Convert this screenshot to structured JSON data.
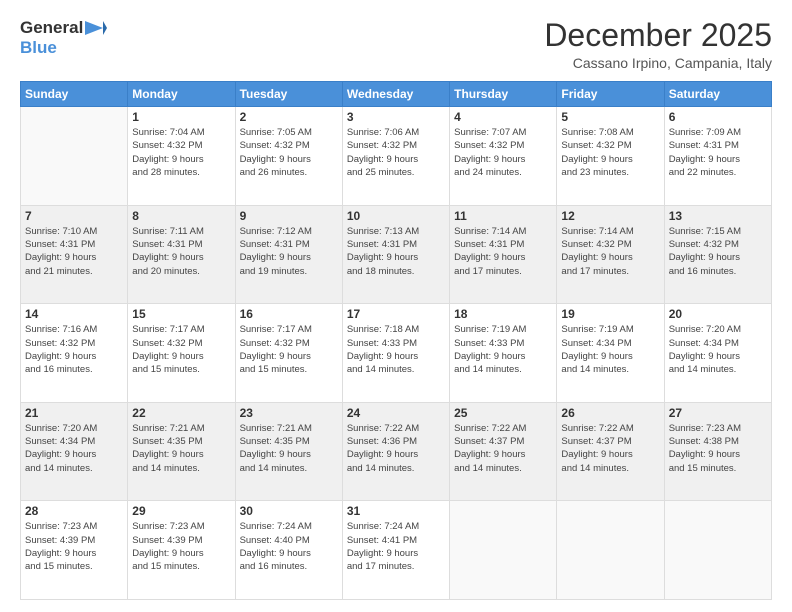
{
  "header": {
    "logo_line1": "General",
    "logo_line2": "Blue",
    "month_title": "December 2025",
    "location": "Cassano Irpino, Campania, Italy"
  },
  "weekdays": [
    "Sunday",
    "Monday",
    "Tuesday",
    "Wednesday",
    "Thursday",
    "Friday",
    "Saturday"
  ],
  "rows": [
    [
      {
        "day": "",
        "info": ""
      },
      {
        "day": "1",
        "info": "Sunrise: 7:04 AM\nSunset: 4:32 PM\nDaylight: 9 hours\nand 28 minutes."
      },
      {
        "day": "2",
        "info": "Sunrise: 7:05 AM\nSunset: 4:32 PM\nDaylight: 9 hours\nand 26 minutes."
      },
      {
        "day": "3",
        "info": "Sunrise: 7:06 AM\nSunset: 4:32 PM\nDaylight: 9 hours\nand 25 minutes."
      },
      {
        "day": "4",
        "info": "Sunrise: 7:07 AM\nSunset: 4:32 PM\nDaylight: 9 hours\nand 24 minutes."
      },
      {
        "day": "5",
        "info": "Sunrise: 7:08 AM\nSunset: 4:32 PM\nDaylight: 9 hours\nand 23 minutes."
      },
      {
        "day": "6",
        "info": "Sunrise: 7:09 AM\nSunset: 4:31 PM\nDaylight: 9 hours\nand 22 minutes."
      }
    ],
    [
      {
        "day": "7",
        "info": "Sunrise: 7:10 AM\nSunset: 4:31 PM\nDaylight: 9 hours\nand 21 minutes."
      },
      {
        "day": "8",
        "info": "Sunrise: 7:11 AM\nSunset: 4:31 PM\nDaylight: 9 hours\nand 20 minutes."
      },
      {
        "day": "9",
        "info": "Sunrise: 7:12 AM\nSunset: 4:31 PM\nDaylight: 9 hours\nand 19 minutes."
      },
      {
        "day": "10",
        "info": "Sunrise: 7:13 AM\nSunset: 4:31 PM\nDaylight: 9 hours\nand 18 minutes."
      },
      {
        "day": "11",
        "info": "Sunrise: 7:14 AM\nSunset: 4:31 PM\nDaylight: 9 hours\nand 17 minutes."
      },
      {
        "day": "12",
        "info": "Sunrise: 7:14 AM\nSunset: 4:32 PM\nDaylight: 9 hours\nand 17 minutes."
      },
      {
        "day": "13",
        "info": "Sunrise: 7:15 AM\nSunset: 4:32 PM\nDaylight: 9 hours\nand 16 minutes."
      }
    ],
    [
      {
        "day": "14",
        "info": "Sunrise: 7:16 AM\nSunset: 4:32 PM\nDaylight: 9 hours\nand 16 minutes."
      },
      {
        "day": "15",
        "info": "Sunrise: 7:17 AM\nSunset: 4:32 PM\nDaylight: 9 hours\nand 15 minutes."
      },
      {
        "day": "16",
        "info": "Sunrise: 7:17 AM\nSunset: 4:32 PM\nDaylight: 9 hours\nand 15 minutes."
      },
      {
        "day": "17",
        "info": "Sunrise: 7:18 AM\nSunset: 4:33 PM\nDaylight: 9 hours\nand 14 minutes."
      },
      {
        "day": "18",
        "info": "Sunrise: 7:19 AM\nSunset: 4:33 PM\nDaylight: 9 hours\nand 14 minutes."
      },
      {
        "day": "19",
        "info": "Sunrise: 7:19 AM\nSunset: 4:34 PM\nDaylight: 9 hours\nand 14 minutes."
      },
      {
        "day": "20",
        "info": "Sunrise: 7:20 AM\nSunset: 4:34 PM\nDaylight: 9 hours\nand 14 minutes."
      }
    ],
    [
      {
        "day": "21",
        "info": "Sunrise: 7:20 AM\nSunset: 4:34 PM\nDaylight: 9 hours\nand 14 minutes."
      },
      {
        "day": "22",
        "info": "Sunrise: 7:21 AM\nSunset: 4:35 PM\nDaylight: 9 hours\nand 14 minutes."
      },
      {
        "day": "23",
        "info": "Sunrise: 7:21 AM\nSunset: 4:35 PM\nDaylight: 9 hours\nand 14 minutes."
      },
      {
        "day": "24",
        "info": "Sunrise: 7:22 AM\nSunset: 4:36 PM\nDaylight: 9 hours\nand 14 minutes."
      },
      {
        "day": "25",
        "info": "Sunrise: 7:22 AM\nSunset: 4:37 PM\nDaylight: 9 hours\nand 14 minutes."
      },
      {
        "day": "26",
        "info": "Sunrise: 7:22 AM\nSunset: 4:37 PM\nDaylight: 9 hours\nand 14 minutes."
      },
      {
        "day": "27",
        "info": "Sunrise: 7:23 AM\nSunset: 4:38 PM\nDaylight: 9 hours\nand 15 minutes."
      }
    ],
    [
      {
        "day": "28",
        "info": "Sunrise: 7:23 AM\nSunset: 4:39 PM\nDaylight: 9 hours\nand 15 minutes."
      },
      {
        "day": "29",
        "info": "Sunrise: 7:23 AM\nSunset: 4:39 PM\nDaylight: 9 hours\nand 15 minutes."
      },
      {
        "day": "30",
        "info": "Sunrise: 7:24 AM\nSunset: 4:40 PM\nDaylight: 9 hours\nand 16 minutes."
      },
      {
        "day": "31",
        "info": "Sunrise: 7:24 AM\nSunset: 4:41 PM\nDaylight: 9 hours\nand 17 minutes."
      },
      {
        "day": "",
        "info": ""
      },
      {
        "day": "",
        "info": ""
      },
      {
        "day": "",
        "info": ""
      }
    ]
  ]
}
